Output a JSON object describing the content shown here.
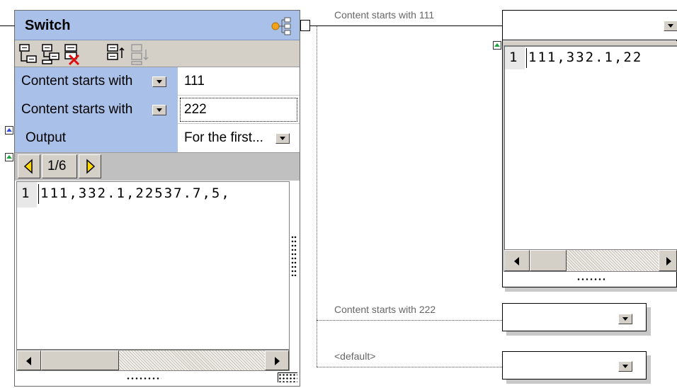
{
  "switch_component": {
    "title": "Switch",
    "toolbar_icons": [
      "insert-condition-icon",
      "append-condition-icon",
      "delete-condition-icon",
      "move-up-icon",
      "move-down-icon"
    ],
    "conditions": [
      {
        "operator": "Content starts with",
        "value": "111"
      },
      {
        "operator": "Content starts with",
        "value": "222"
      }
    ],
    "output": {
      "label": "Output",
      "value": "For the first..."
    },
    "pager": {
      "text": "1/6"
    },
    "preview": {
      "line_number": "1",
      "text": "111,332.1,22537.7,5,"
    }
  },
  "connections": {
    "labels": [
      "Content starts with 111",
      "Content starts with 222",
      "<default>"
    ]
  },
  "output_preview": {
    "line_number": "1",
    "text": "111,332.1,22"
  }
}
